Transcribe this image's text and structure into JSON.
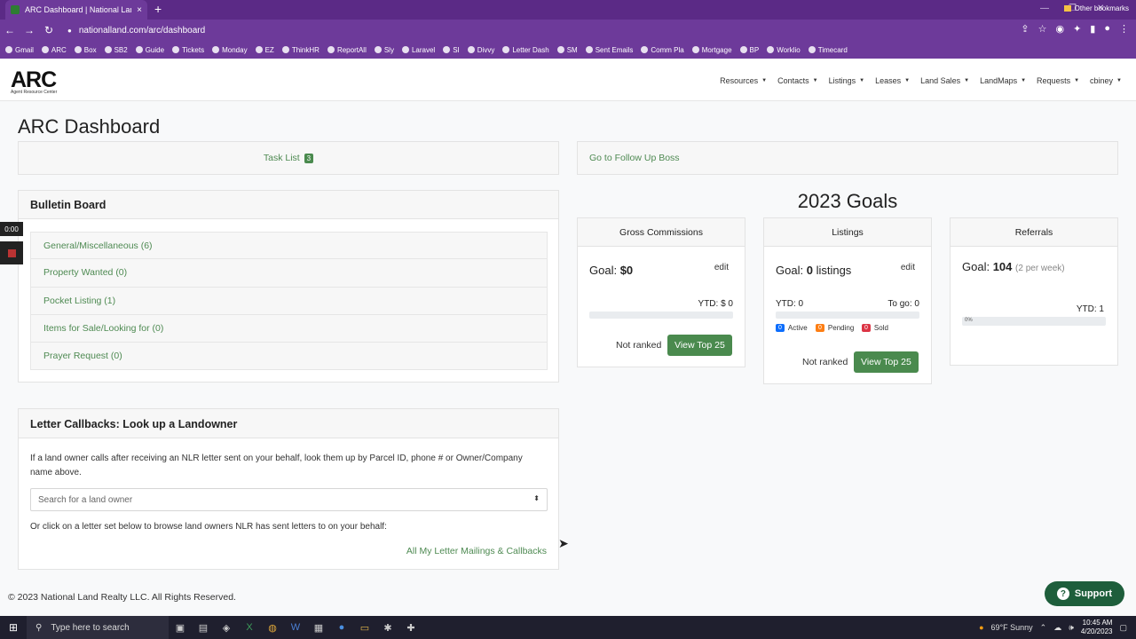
{
  "browser": {
    "tab_title": "ARC Dashboard | National Land",
    "tab_close": "×",
    "new_tab": "+",
    "url": "nationalland.com/arc/dashboard",
    "bookmarks": [
      "Gmail",
      "ARC",
      "Box",
      "SB2",
      "Guide",
      "Tickets",
      "Monday",
      "EZ",
      "ThinkHR",
      "ReportAll",
      "Sly",
      "Laravel",
      "SI",
      "Divvy",
      "Letter Dash",
      "SM",
      "Sent Emails",
      "Comm Pla",
      "Mortgage",
      "BP",
      "Worklio",
      "Timecard"
    ],
    "other_bookmarks": "Other bookmarks"
  },
  "nav": {
    "logo": "ARC",
    "logo_sub": "Agent Resource Center",
    "items": [
      "Resources",
      "Contacts",
      "Listings",
      "Leases",
      "Land Sales",
      "LandMaps",
      "Requests",
      "cbiney"
    ]
  },
  "page": {
    "title": "ARC Dashboard",
    "task_list": "Task List",
    "task_count": "3",
    "follow_up": "Go to Follow Up Boss"
  },
  "bulletin": {
    "title": "Bulletin Board",
    "items": [
      "General/Miscellaneous (6)",
      "Property Wanted (0)",
      "Pocket Listing (1)",
      "Items for Sale/Looking for (0)",
      "Prayer Request (0)"
    ]
  },
  "recorder": {
    "time": "0:00"
  },
  "goals": {
    "title": "2023 Goals",
    "gross": {
      "title": "Gross Commissions",
      "goal_label": "Goal:",
      "goal_value": "$0",
      "edit": "edit",
      "ytd": "YTD:  $ 0",
      "progress": 0,
      "rank": "Not ranked",
      "button": "View Top 25"
    },
    "listings": {
      "title": "Listings",
      "goal_label": "Goal:",
      "goal_value": "0",
      "goal_unit": "listings",
      "edit": "edit",
      "ytd": "YTD:  0",
      "to_go": "To go:  0",
      "progress": 0,
      "active_count": "0",
      "active": "Active",
      "pending_count": "0",
      "pending": "Pending",
      "sold_count": "0",
      "sold": "Sold",
      "rank": "Not ranked",
      "button": "View Top 25"
    },
    "referrals": {
      "title": "Referrals",
      "goal_label": "Goal:",
      "goal_value": "104",
      "goal_note": "(2 per week)",
      "ytd": "YTD:  1",
      "progress_label": "0%",
      "progress": 0
    }
  },
  "letter": {
    "title": "Letter Callbacks: Look up a Landowner",
    "description": "If a land owner calls after receiving an NLR letter sent on your behalf, look them up by Parcel ID, phone # or Owner/Company name above.",
    "search_placeholder": "Search for a land owner",
    "or_text": "Or click on a letter set below to browse land owners NLR has sent letters to on your behalf:",
    "all_link": "All My Letter Mailings & Callbacks"
  },
  "footer": "© 2023 National Land Realty LLC. All Rights Reserved.",
  "support": "Support",
  "taskbar": {
    "search": "Type here to search",
    "weather": "69°F  Sunny",
    "time": "10:45 AM",
    "date": "4/20/2023"
  },
  "colors": {
    "accent": "#4a8a4e",
    "browser": "#6d3a9a",
    "active": "#0d6efd",
    "pending": "#fd7e14",
    "sold": "#dc3545"
  }
}
